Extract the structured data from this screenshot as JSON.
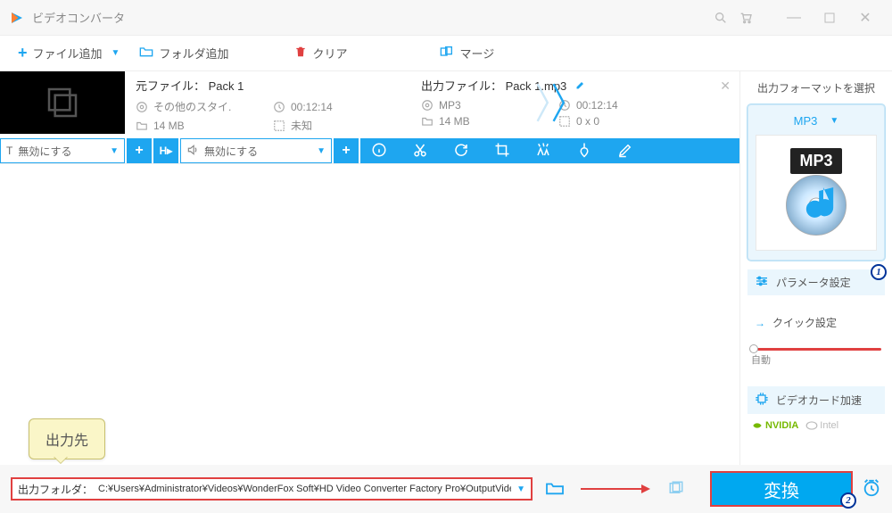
{
  "title": "ビデオコンバータ",
  "toolbar": {
    "add_file": "ファイル追加",
    "add_folder": "フォルダ追加",
    "clear": "クリア",
    "merge": "マージ"
  },
  "file": {
    "source_label": "元ファイル：",
    "source_name": "Pack 1",
    "output_label": "出力ファイル：",
    "output_name": "Pack 1.mp3",
    "src_format": "その他のスタイ.",
    "src_duration": "00:12:14",
    "src_size": "14 MB",
    "src_res": "未知",
    "out_format": "MP3",
    "out_duration": "00:12:14",
    "out_size": "14 MB",
    "out_res": "0 x 0"
  },
  "editbar": {
    "disable1": "無効にする",
    "disable2": "無効にする"
  },
  "sidebar": {
    "header": "出力フォーマットを選択",
    "format": "MP3",
    "format_badge": "MP3",
    "param_setting": "パラメータ設定",
    "quick_setting": "クイック設定",
    "slider_label": "自動",
    "gpu_accel": "ビデオカード加速",
    "nvidia": "NVIDIA",
    "intel": "Intel"
  },
  "bottom": {
    "out_folder_label": "出力フォルダ：",
    "out_folder_path": "C:¥Users¥Administrator¥Videos¥WonderFox Soft¥HD Video Converter Factory Pro¥OutputVideo¥",
    "convert": "変換"
  },
  "callout": "出力先",
  "annot": {
    "one": "1",
    "two": "2"
  }
}
